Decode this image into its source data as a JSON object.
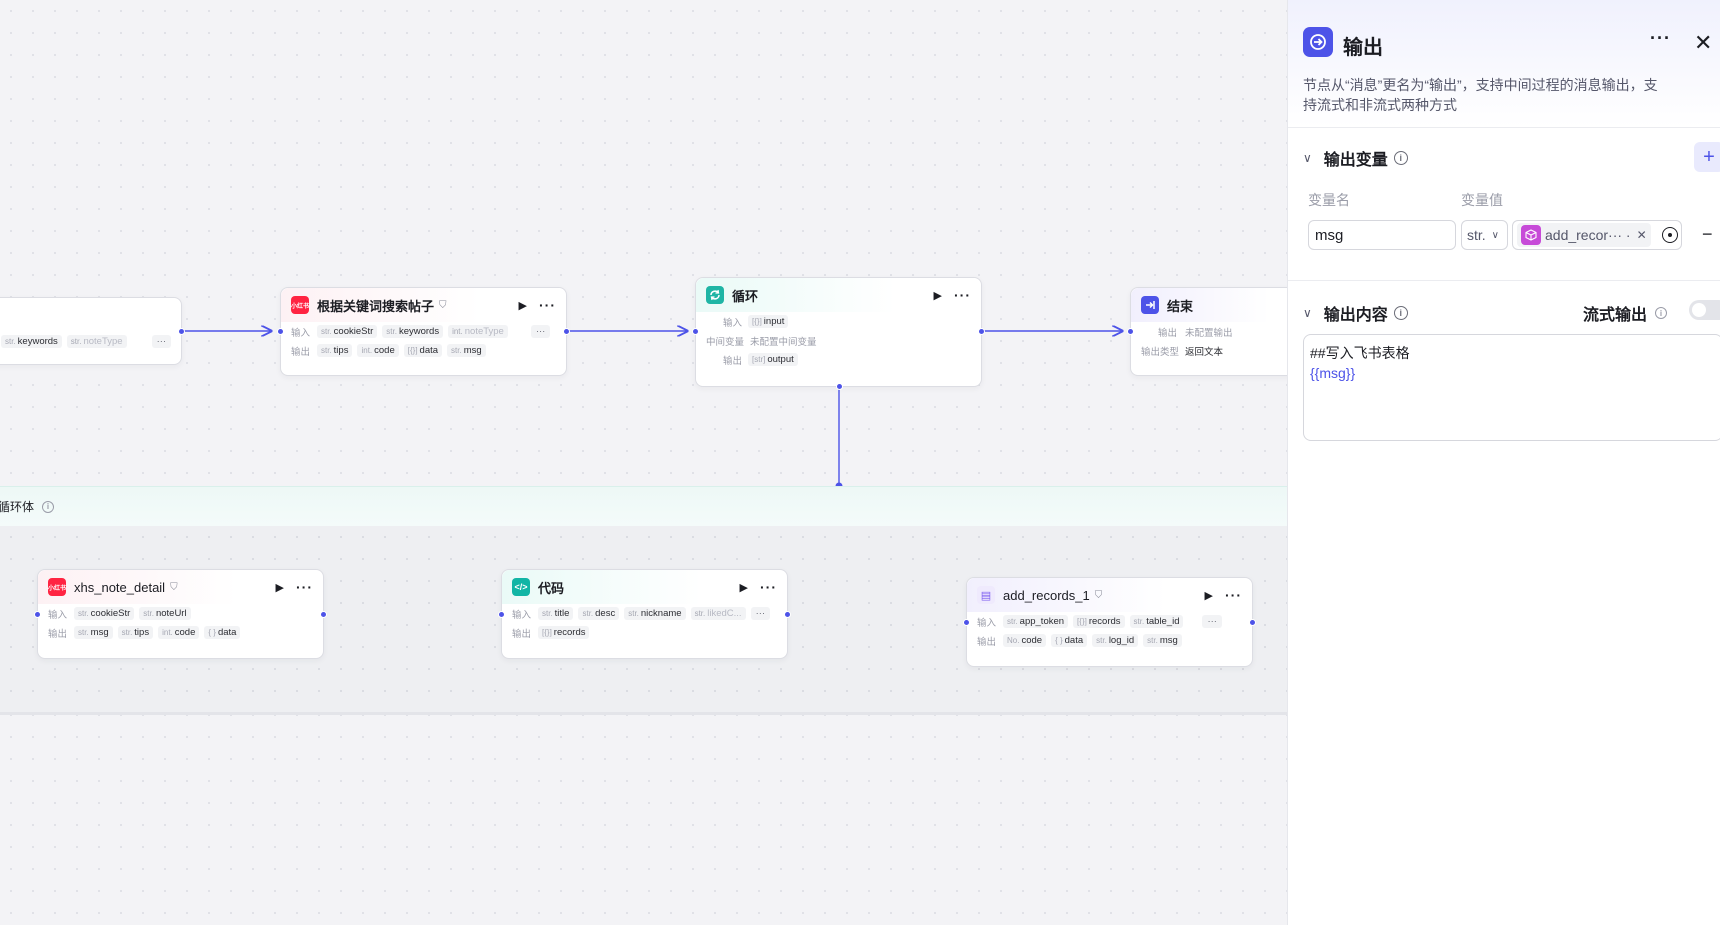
{
  "panel": {
    "title": "输出",
    "description_line1": "节点从“消息”更名为“输出”，支持中间过程的消息输出，支",
    "description_line2": "持流式和非流式两种方式",
    "output_vars_section": "输出变量",
    "var_name_header": "变量名",
    "var_value_header": "变量值",
    "var_name_value": "msg",
    "var_type": "str.",
    "var_ref": "add_recor··· ·",
    "output_content_section": "输出内容",
    "stream_label": "流式输出",
    "content_line1": "##写入飞书表格",
    "content_line2": "{{msg}}"
  },
  "loop_band": {
    "label": "循环体"
  },
  "nodes": {
    "start_partial": {
      "inputs": [
        {
          "type": "str.",
          "name": "keywords"
        },
        {
          "type": "str.",
          "name": "noteType"
        }
      ],
      "more": "···"
    },
    "search": {
      "title": "根据关键词搜索帖子",
      "icon_text": "小红书",
      "in_label": "输入",
      "out_label": "输出",
      "inputs": [
        {
          "type": "str.",
          "name": "cookieStr"
        },
        {
          "type": "str.",
          "name": "keywords"
        },
        {
          "type": "int.",
          "name": "noteType"
        }
      ],
      "outputs": [
        {
          "type": "str.",
          "name": "tips"
        },
        {
          "type": "int.",
          "name": "code"
        },
        {
          "type": "[{}]",
          "name": "data"
        },
        {
          "type": "str.",
          "name": "msg"
        }
      ],
      "more": "···"
    },
    "loop": {
      "title": "循环",
      "in_label": "输入",
      "mid_label": "中间变量",
      "mid_value": "未配置中间变量",
      "out_label": "输出",
      "input": {
        "type": "[{}]",
        "name": "input"
      },
      "output": {
        "type": "[str]",
        "name": "output"
      }
    },
    "end": {
      "title": "结束",
      "out_label": "输出",
      "out_value": "未配置输出",
      "type_label": "输出类型",
      "type_value": "返回文本"
    },
    "note_detail": {
      "title": "xhs_note_detail",
      "icon_text": "小红书",
      "in_label": "输入",
      "out_label": "输出",
      "inputs": [
        {
          "type": "str.",
          "name": "cookieStr"
        },
        {
          "type": "str.",
          "name": "noteUrl"
        }
      ],
      "outputs": [
        {
          "type": "str.",
          "name": "msg"
        },
        {
          "type": "str.",
          "name": "tips"
        },
        {
          "type": "int.",
          "name": "code"
        },
        {
          "type": "{ }",
          "name": "data"
        }
      ]
    },
    "code": {
      "title": "代码",
      "in_label": "输入",
      "out_label": "输出",
      "inputs": [
        {
          "type": "str.",
          "name": "title"
        },
        {
          "type": "str.",
          "name": "desc"
        },
        {
          "type": "str.",
          "name": "nickname"
        },
        {
          "type": "str.",
          "name": "likedC..."
        }
      ],
      "outputs": [
        {
          "type": "[{}]",
          "name": "records"
        }
      ],
      "more": "···"
    },
    "add_records": {
      "title": "add_records_1",
      "in_label": "输入",
      "out_label": "输出",
      "inputs": [
        {
          "type": "str.",
          "name": "app_token"
        },
        {
          "type": "[{}]",
          "name": "records"
        },
        {
          "type": "str.",
          "name": "table_id"
        }
      ],
      "outputs": [
        {
          "type": "No.",
          "name": "code"
        },
        {
          "type": "{ }",
          "name": "data"
        },
        {
          "type": "str.",
          "name": "log_id"
        },
        {
          "type": "str.",
          "name": "msg"
        }
      ],
      "more": "···"
    }
  },
  "colors": {
    "accent": "#4d53e8",
    "xhs_red": "#ff2442",
    "loop_teal": "#1fb5a5",
    "code_teal": "#12b5a5",
    "records_purple": "#7b5cf0",
    "plugin_purple": "#c74bd8"
  }
}
